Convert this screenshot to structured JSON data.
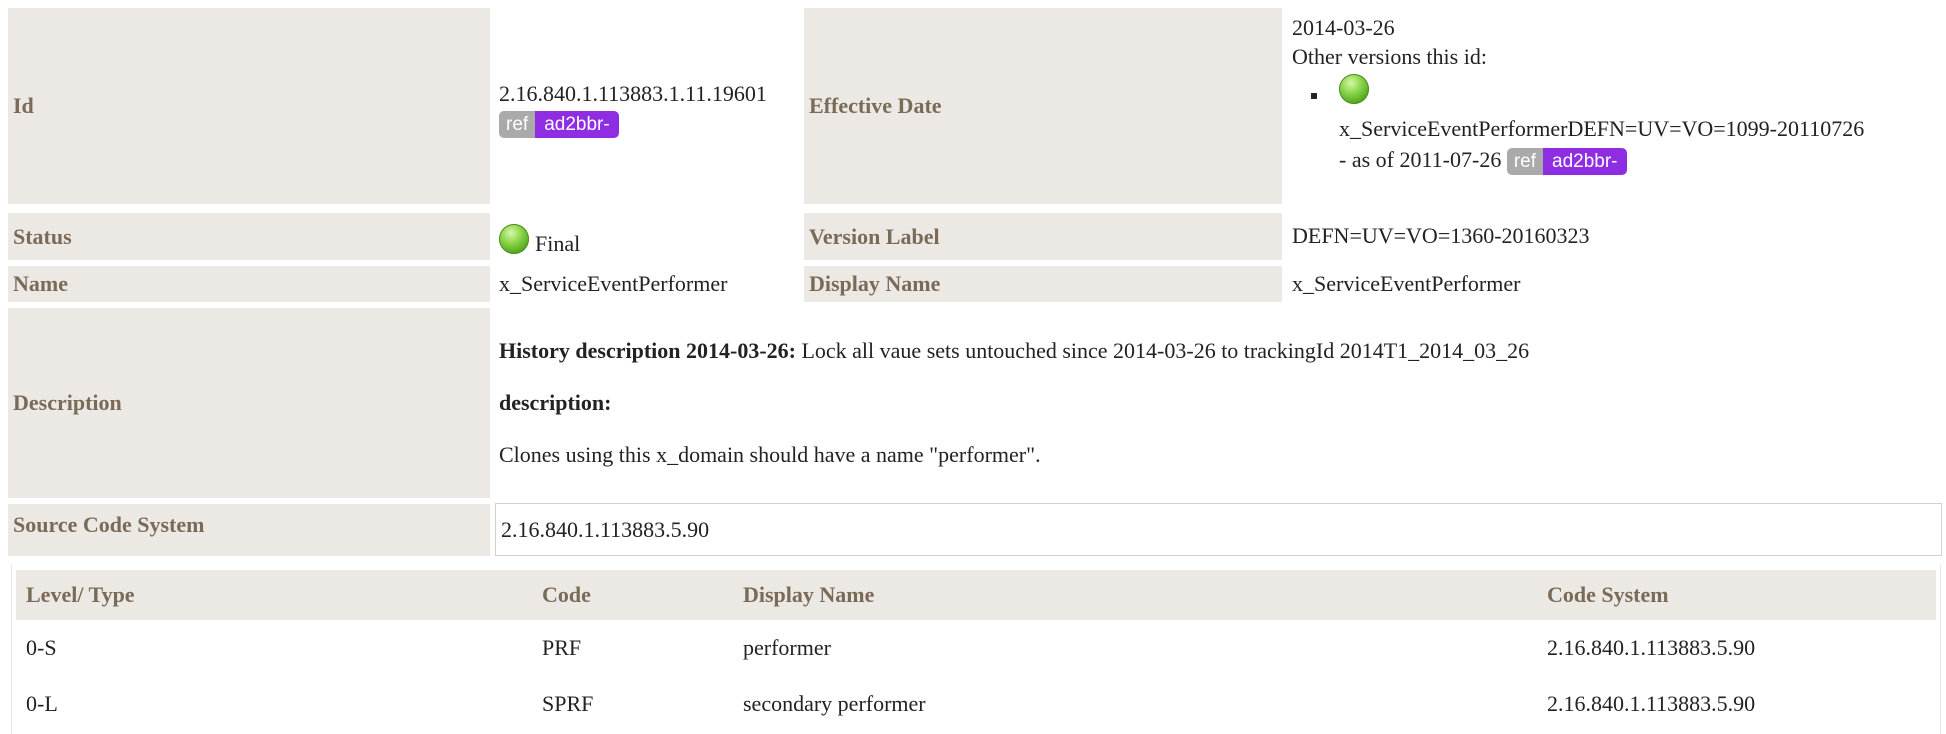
{
  "fields": {
    "id_label": "Id",
    "id_value": "2.16.840.1.113883.1.11.19601",
    "effective_date_label": "Effective Date",
    "effective_date_value": "2014-03-26",
    "other_versions_label": "Other versions this id:",
    "other_version": {
      "name": "x_ServiceEventPerformerDEFN=UV=VO=1099-20110726",
      "as_of": "- as of 2011-07-26"
    },
    "status_label": "Status",
    "status_value": "Final",
    "version_label_label": "Version Label",
    "version_label_value": "DEFN=UV=VO=1360-20160323",
    "name_label": "Name",
    "name_value": "x_ServiceEventPerformer",
    "display_name_label": "Display Name",
    "display_name_value": "x_ServiceEventPerformer",
    "description_label": "Description",
    "history_description_heading": "History description 2014-03-26:",
    "history_description_text": "Lock all vaue sets untouched since 2014-03-26 to trackingId 2014T1_2014_03_26",
    "description_heading": "description:",
    "description_text": "Clones using this x_domain should have a name \"performer\".",
    "source_code_system_label": "Source Code System",
    "source_code_system_value": "2.16.840.1.113883.5.90"
  },
  "badges": {
    "ref": "ref",
    "id": "ad2bbr-"
  },
  "colors": {
    "label_bg": "#ece9e4",
    "label_text": "#7a6a58",
    "badge_ref": "#aaaaaa",
    "badge_id": "#8e2de2",
    "status_final": "#6cc12f"
  },
  "icons": {
    "status": "green-status-ball-icon"
  },
  "code_table": {
    "headers": [
      "Level/ Type",
      "Code",
      "Display Name",
      "Code System"
    ],
    "rows": [
      [
        "0-S",
        "PRF",
        "performer",
        "2.16.840.1.113883.5.90"
      ],
      [
        "0-L",
        "SPRF",
        "secondary performer",
        "2.16.840.1.113883.5.90"
      ]
    ]
  }
}
